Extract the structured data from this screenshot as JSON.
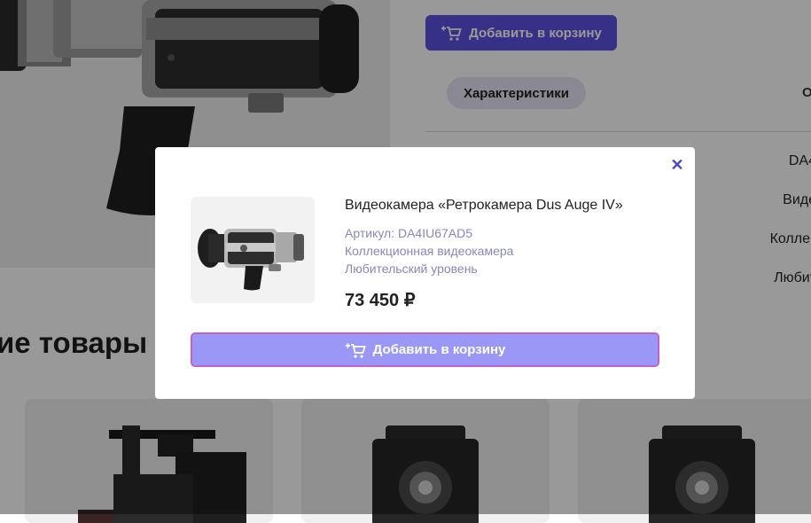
{
  "page": {
    "add_to_cart_label": "Добавить в корзину",
    "tabs": [
      {
        "label": "Характеристики"
      },
      {
        "label": "О"
      }
    ],
    "spec_values": [
      "DA4",
      "Виде",
      "Коллек",
      "Любит"
    ],
    "section_heading": "ие товары"
  },
  "modal": {
    "close_symbol": "✕",
    "title": "Видеокамера «Ретрокамера Dus Auge IV»",
    "article": "Артикул: DA4IU67AD5",
    "category": "Коллекционная видеокамера",
    "level": "Любительский уровень",
    "price": "73 450 ₽",
    "add_to_cart_label": "Добавить в корзину"
  },
  "colors": {
    "accent": "#5b52e0",
    "accent_light": "#9b97f7",
    "meta_text": "#8a86bb",
    "focus_border": "#c45fcf"
  },
  "icons": {
    "cart": "cart-plus-icon",
    "close": "close-icon"
  }
}
